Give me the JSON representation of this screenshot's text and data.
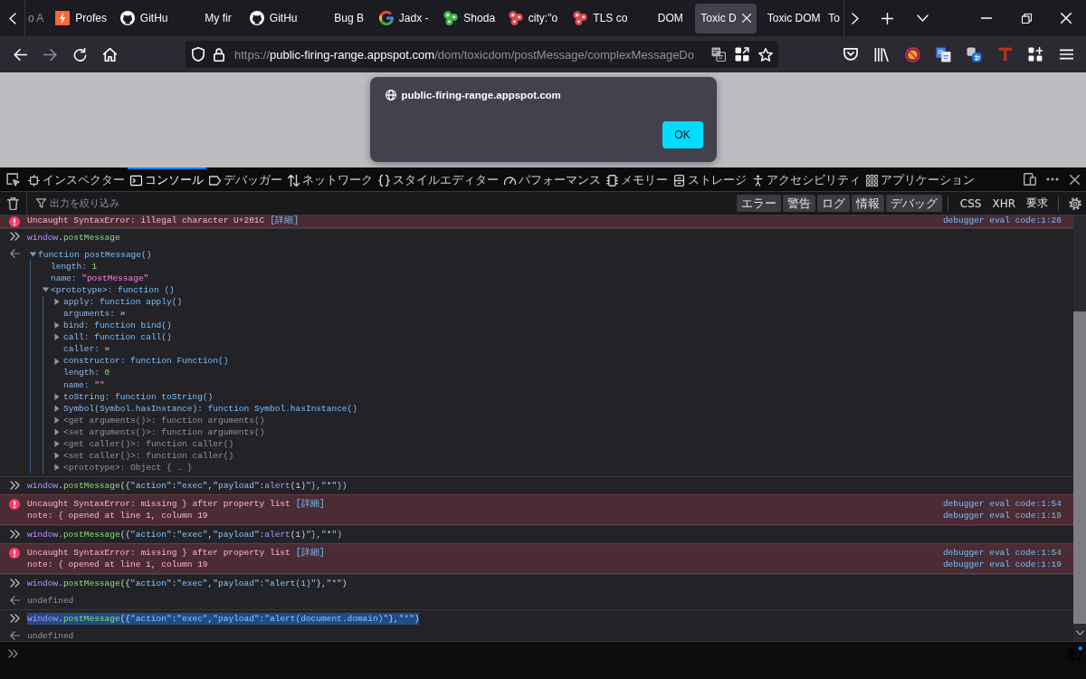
{
  "browser_tabs": [
    {
      "title": "o A",
      "kind": "plain",
      "selected": false
    },
    {
      "title": "Profes",
      "kind": "lightning",
      "selected": false
    },
    {
      "title": "GitHu",
      "kind": "cat",
      "selected": false
    },
    {
      "title": "My fir",
      "kind": "blank",
      "selected": false
    },
    {
      "title": "GitHu",
      "kind": "cat",
      "selected": false
    },
    {
      "title": "Bug B",
      "kind": "blank",
      "selected": false
    },
    {
      "title": "Jadx -",
      "kind": "g_logo",
      "selected": false
    },
    {
      "title": "Shoda",
      "kind": "dots",
      "color": "#3fb548",
      "selected": false
    },
    {
      "title": "city:\"o",
      "kind": "dots",
      "color": "#e0474c",
      "selected": false
    },
    {
      "title": "TLS co",
      "kind": "dots",
      "color": "#e0474c",
      "selected": false
    },
    {
      "title": "DOM",
      "kind": "blank",
      "selected": false
    },
    {
      "title": "Toxic D",
      "kind": "plain",
      "selected": true
    },
    {
      "title": "Toxic DOM",
      "kind": "plain",
      "selected": false
    },
    {
      "title": "To",
      "kind": "plain",
      "selected": false
    }
  ],
  "navigation": {
    "back": {
      "disabled": false
    },
    "forward": {
      "disabled": true
    }
  },
  "address_bar": {
    "scheme": "https://",
    "host": "public-firing-range.appspot.com",
    "path": "/dom/toxicdom/postMessage/complexMessageDo"
  },
  "dialog": {
    "origin": "public-firing-range.appspot.com",
    "button": "OK"
  },
  "devtools": {
    "tabs": [
      {
        "label": "インスペクター",
        "kind": "inspector",
        "selected": false
      },
      {
        "label": "コンソール",
        "kind": "console",
        "selected": true
      },
      {
        "label": "デバッガー",
        "kind": "debugger",
        "selected": false
      },
      {
        "label": "ネットワーク",
        "kind": "network",
        "selected": false
      },
      {
        "label": "スタイルエディター",
        "kind": "style",
        "selected": false
      },
      {
        "label": "パフォーマンス",
        "kind": "performance",
        "selected": false
      },
      {
        "label": "メモリー",
        "kind": "memory",
        "selected": false
      },
      {
        "label": "ストレージ",
        "kind": "storage",
        "selected": false
      },
      {
        "label": "アクセシビリティ",
        "kind": "accessibility",
        "selected": false
      },
      {
        "label": "アプリケーション",
        "kind": "application",
        "selected": false
      }
    ],
    "filter": {
      "placeholder": "出力を絞り込み"
    },
    "level_filters": [
      {
        "label": "エラー",
        "on": true
      },
      {
        "label": "警告",
        "on": true
      },
      {
        "label": "ログ",
        "on": true
      },
      {
        "label": "情報",
        "on": true
      },
      {
        "label": "デバッグ",
        "on": true
      }
    ],
    "type_filters": [
      {
        "label": "CSS",
        "on": false
      },
      {
        "label": "XHR",
        "on": false
      },
      {
        "label": "要求",
        "on": false
      }
    ]
  },
  "console": [
    {
      "kind": "error",
      "message": "Uncaught SyntaxError: illegal character U+201C",
      "link": "[詳細]",
      "locations": [
        "debugger eval code:1:26"
      ]
    },
    {
      "kind": "input",
      "code": "window.postMessage",
      "selected": false
    },
    {
      "kind": "tree",
      "root": {
        "label": "function postMessage()",
        "kind": "function",
        "expanded": true,
        "children": [
          {
            "key": "length:",
            "value": "1",
            "kind": "number"
          },
          {
            "key": "name:",
            "value": "\"postMessage\"",
            "kind": "string"
          },
          {
            "key": "<prototype>:",
            "value": "function ()",
            "kind": "function",
            "expanded": true,
            "children": [
              {
                "key": "apply:",
                "value": "function apply()",
                "kind": "function",
                "expanded": false
              },
              {
                "key": "arguments:",
                "value": "»",
                "kind": "getter"
              },
              {
                "key": "bind:",
                "value": "function bind()",
                "kind": "function",
                "expanded": false
              },
              {
                "key": "call:",
                "value": "function call()",
                "kind": "function",
                "expanded": false
              },
              {
                "key": "caller:",
                "value": "»",
                "kind": "getter"
              },
              {
                "key": "constructor:",
                "value": "function Function()",
                "kind": "function",
                "expanded": false
              },
              {
                "key": "length:",
                "value": "0",
                "kind": "number"
              },
              {
                "key": "name:",
                "value": "\"\"",
                "kind": "string"
              },
              {
                "key": "toString:",
                "value": "function toString()",
                "kind": "function",
                "expanded": false
              },
              {
                "key": "Symbol(Symbol.hasInstance):",
                "value": "function Symbol.hasInstance()",
                "kind": "function",
                "expanded": false
              },
              {
                "key": "<get arguments()>:",
                "value": "function arguments()",
                "kind": "accessor",
                "expanded": false
              },
              {
                "key": "<set arguments()>:",
                "value": "function arguments()",
                "kind": "accessor",
                "expanded": false
              },
              {
                "key": "<get caller()>:",
                "value": "function caller()",
                "kind": "accessor",
                "expanded": false
              },
              {
                "key": "<set caller()>:",
                "value": "function caller()",
                "kind": "accessor",
                "expanded": false
              },
              {
                "key": "<prototype>:",
                "value": "Object { … }",
                "kind": "object",
                "expanded": false
              }
            ]
          }
        ]
      }
    },
    {
      "kind": "input",
      "code": "window.postMessage({\"action\":\"exec\",\"payload\":alert(1)\"},\"*\"})",
      "selected": false
    },
    {
      "kind": "error",
      "message": "Uncaught SyntaxError: missing } after property list",
      "link": "[詳細]",
      "note": "note: { opened at line 1, column 19",
      "locations": [
        "debugger eval code:1:54",
        "debugger eval code:1:19"
      ]
    },
    {
      "kind": "input",
      "code": "window.postMessage({\"action\":\"exec\",\"payload\":alert(1)\"},\"*\")",
      "selected": false
    },
    {
      "kind": "error",
      "message": "Uncaught SyntaxError: missing } after property list",
      "link": "[詳細]",
      "note": "note: { opened at line 1, column 19",
      "locations": [
        "debugger eval code:1:54",
        "debugger eval code:1:19"
      ]
    },
    {
      "kind": "input",
      "code": "window.postMessage({\"action\":\"exec\",\"payload\":\"alert(1)\"},\"*\")",
      "selected": false
    },
    {
      "kind": "result",
      "text": "undefined"
    },
    {
      "kind": "input",
      "code": "window.postMessage({\"action\":\"exec\",\"payload\":\"alert(document.domain)\"},\"*\")",
      "selected": true
    },
    {
      "kind": "result",
      "text": "undefined"
    }
  ]
}
